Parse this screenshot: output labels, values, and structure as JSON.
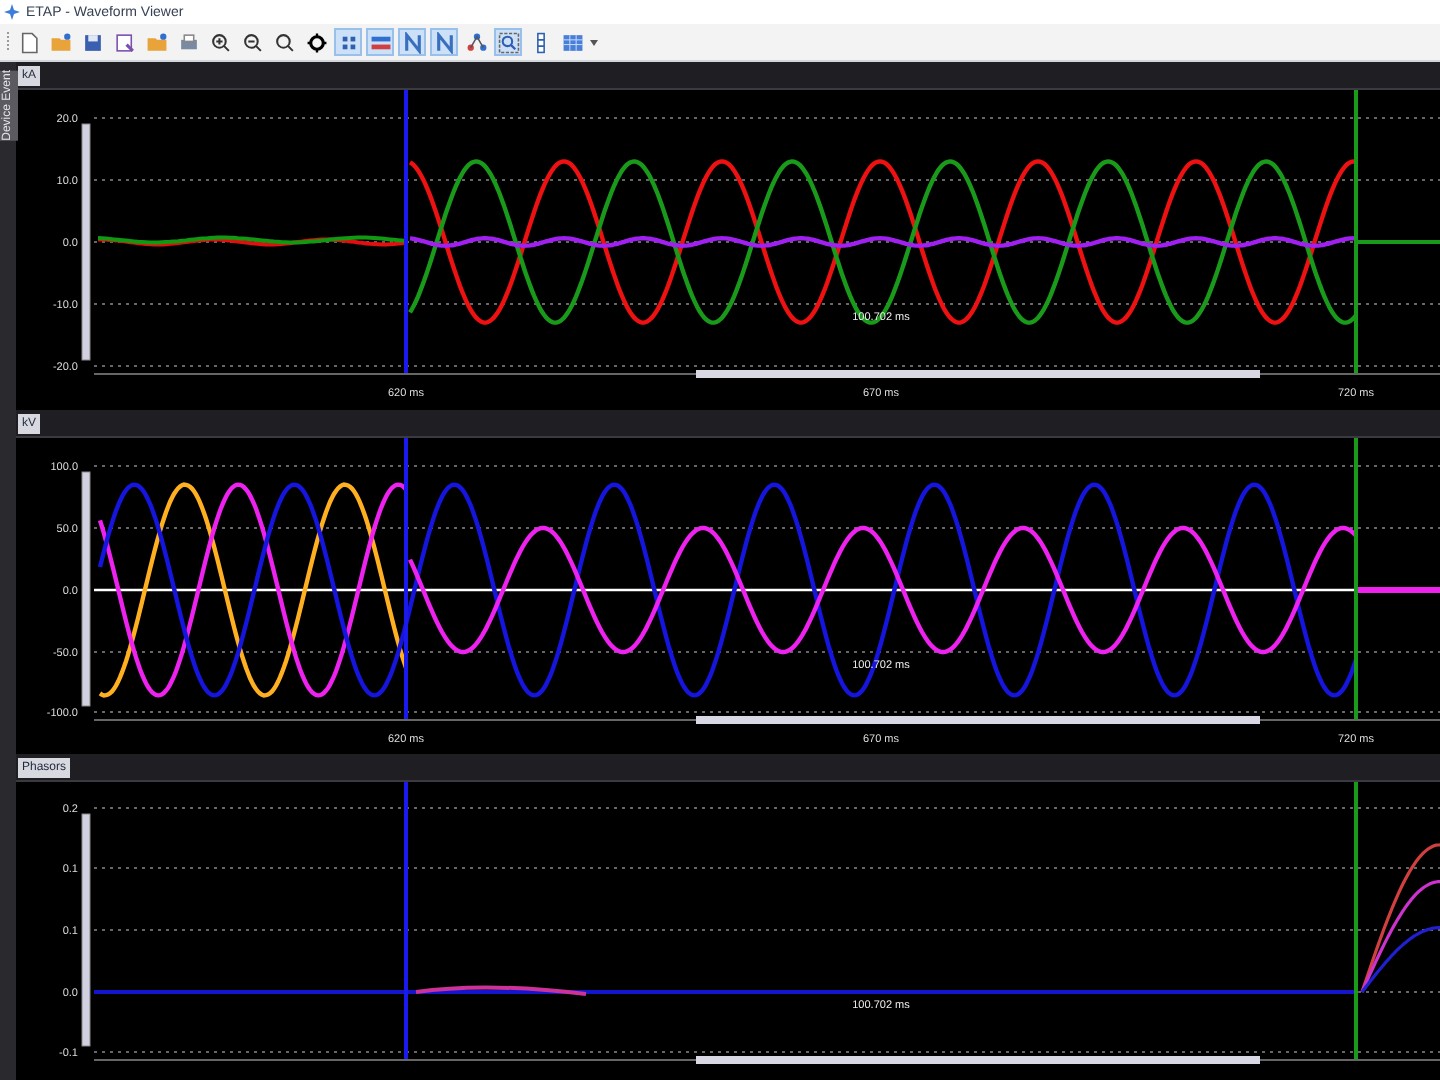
{
  "window": {
    "title": "ETAP - Waveform Viewer"
  },
  "toolbar": [
    {
      "kind": "new-file",
      "selected": false
    },
    {
      "kind": "open-folder",
      "selected": false
    },
    {
      "kind": "save",
      "selected": false
    },
    {
      "kind": "document",
      "selected": false
    },
    {
      "kind": "open-folder",
      "selected": false
    },
    {
      "kind": "print",
      "selected": false
    },
    {
      "kind": "zoom-in",
      "selected": false
    },
    {
      "kind": "zoom-out",
      "selected": false
    },
    {
      "kind": "search",
      "selected": false
    },
    {
      "kind": "diamond",
      "selected": false
    },
    {
      "kind": "grid",
      "selected": true
    },
    {
      "kind": "legend",
      "selected": true
    },
    {
      "kind": "zigzag",
      "selected": true
    },
    {
      "kind": "zigzag",
      "selected": true
    },
    {
      "kind": "network",
      "selected": false
    },
    {
      "kind": "zoom-box",
      "selected": true
    },
    {
      "kind": "column",
      "selected": false
    },
    {
      "kind": "table",
      "selected": false
    }
  ],
  "side_tab": {
    "label": "Device Event"
  },
  "panels": [
    {
      "kind": "current",
      "title": "kA",
      "y_ticks": [
        "20.0",
        "10.0",
        "0.0",
        "-10.0",
        "-20.0"
      ],
      "cursor_label": "100.702 ms",
      "x_labels": [
        "620 ms",
        "670 ms",
        "720 ms"
      ]
    },
    {
      "kind": "voltage",
      "title": "kV",
      "y_ticks": [
        "100.0",
        "50.0",
        "0.0",
        "-50.0",
        "-100.0"
      ],
      "cursor_label": "100.702 ms",
      "x_labels": [
        "620 ms",
        "670 ms",
        "720 ms"
      ]
    },
    {
      "kind": "phasor",
      "title": "Phasors",
      "y_ticks": [
        "0.2",
        "0.1",
        "0.1",
        "0.0",
        "-0.1"
      ],
      "cursor_label": "100.702 ms"
    }
  ]
}
